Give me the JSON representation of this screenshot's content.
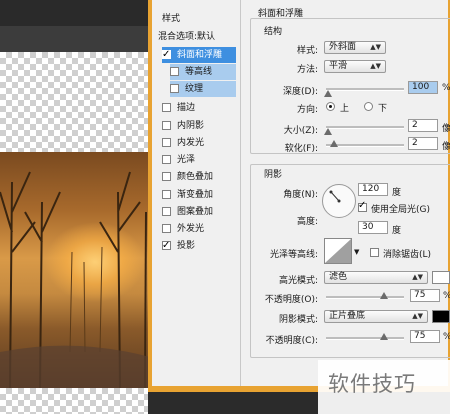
{
  "styles_panel": {
    "header": "样式",
    "blend_options": "混合选项:默认",
    "items": [
      {
        "label": "斜面和浮雕",
        "checked": true,
        "state": "selected"
      },
      {
        "label": "等高线",
        "checked": false,
        "state": "sub"
      },
      {
        "label": "纹理",
        "checked": false,
        "state": "sub"
      },
      {
        "label": "描边",
        "checked": false,
        "state": ""
      },
      {
        "label": "内阴影",
        "checked": false,
        "state": ""
      },
      {
        "label": "内发光",
        "checked": false,
        "state": ""
      },
      {
        "label": "光泽",
        "checked": false,
        "state": ""
      },
      {
        "label": "颜色叠加",
        "checked": false,
        "state": ""
      },
      {
        "label": "渐变叠加",
        "checked": false,
        "state": ""
      },
      {
        "label": "图案叠加",
        "checked": false,
        "state": ""
      },
      {
        "label": "外发光",
        "checked": false,
        "state": ""
      },
      {
        "label": "投影",
        "checked": true,
        "state": ""
      }
    ]
  },
  "bevel": {
    "section_title": "斜面和浮雕",
    "structure_title": "结构",
    "style_label": "样式:",
    "style_value": "外斜面",
    "technique_label": "方法:",
    "technique_value": "平滑",
    "depth_label": "深度(D):",
    "depth_value": "100",
    "depth_unit": "%",
    "direction_label": "方向:",
    "direction_up": "上",
    "direction_down": "下",
    "size_label": "大小(Z):",
    "size_value": "2",
    "size_unit": "像",
    "soften_label": "软化(F):",
    "soften_value": "2",
    "soften_unit": "像"
  },
  "shading": {
    "title": "阴影",
    "angle_label": "角度(N):",
    "angle_value": "120",
    "angle_unit": "度",
    "global_light_label": "使用全局光(G)",
    "altitude_label": "高度:",
    "altitude_value": "30",
    "altitude_unit": "度",
    "gloss_contour_label": "光泽等高线:",
    "anti_alias_label": "消除锯齿(L)",
    "highlight_mode_label": "高光模式:",
    "highlight_mode_value": "滤色",
    "opacity1_label": "不透明度(O):",
    "opacity1_value": "75",
    "opacity1_unit": "%",
    "shadow_mode_label": "阴影模式:",
    "shadow_mode_value": "正片叠底",
    "opacity2_label": "不透明度(C):",
    "opacity2_value": "75",
    "opacity2_unit": "%"
  },
  "watermark": "软件技巧",
  "colors": {
    "dialog_border": "#e8a332",
    "selection": "#3e8fe0",
    "highlight_field": "#a9ccee",
    "shadow_swatch": "#000000"
  }
}
